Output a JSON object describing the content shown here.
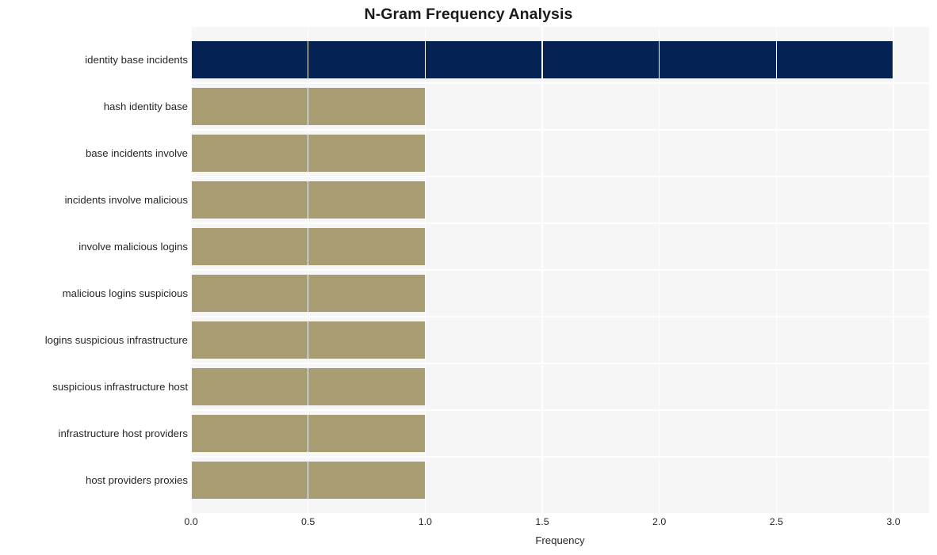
{
  "chart_data": {
    "type": "bar",
    "orientation": "horizontal",
    "title": "N-Gram Frequency Analysis",
    "xlabel": "Frequency",
    "ylabel": "",
    "categories": [
      "identity base incidents",
      "hash identity base",
      "base incidents involve",
      "incidents involve malicious",
      "involve malicious logins",
      "malicious logins suspicious",
      "logins suspicious infrastructure",
      "suspicious infrastructure host",
      "infrastructure host providers",
      "host providers proxies"
    ],
    "values": [
      3.0,
      1.0,
      1.0,
      1.0,
      1.0,
      1.0,
      1.0,
      1.0,
      1.0,
      1.0
    ],
    "xlim": [
      0.0,
      3.0
    ],
    "xticks": [
      "0.0",
      "0.5",
      "1.0",
      "1.5",
      "2.0",
      "2.5",
      "3.0"
    ],
    "xtick_values": [
      0.0,
      0.5,
      1.0,
      1.5,
      2.0,
      2.5,
      3.0
    ],
    "grid": true,
    "legend": false,
    "bar_colors": [
      "#042253",
      "#a89c72",
      "#a89c72",
      "#a89c72",
      "#a89c72",
      "#a89c72",
      "#a89c72",
      "#a89c72",
      "#a89c72",
      "#a89c72"
    ],
    "plot_background": "#f6f6f7",
    "grid_color": "#ffffff",
    "text_color": "#262626",
    "title_color": "#1a1a1a"
  }
}
